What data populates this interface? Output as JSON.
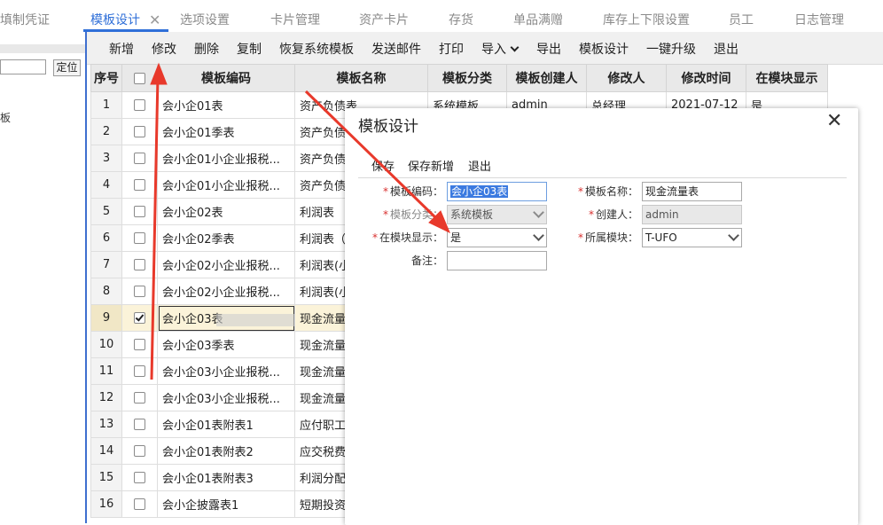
{
  "tabs": [
    {
      "label": "填制凭证"
    },
    {
      "label": "模板设计"
    },
    {
      "label": "选项设置"
    },
    {
      "label": "卡片管理"
    },
    {
      "label": "资产卡片"
    },
    {
      "label": "存货"
    },
    {
      "label": "单品满赠"
    },
    {
      "label": "库存上下限设置"
    },
    {
      "label": "员工"
    },
    {
      "label": "日志管理"
    }
  ],
  "left_panel": {
    "locate_button": "定位",
    "text": "板"
  },
  "toolbar": {
    "buttons": [
      {
        "label": "新增"
      },
      {
        "label": "修改"
      },
      {
        "label": "删除"
      },
      {
        "label": "复制"
      },
      {
        "label": "恢复系统模板"
      },
      {
        "label": "发送邮件"
      },
      {
        "label": "打印"
      },
      {
        "label": "导入"
      },
      {
        "label": "导出"
      },
      {
        "label": "模板设计"
      },
      {
        "label": "一键升级"
      },
      {
        "label": "退出"
      }
    ]
  },
  "grid": {
    "headers": {
      "idx": "序号",
      "code": "模板编码",
      "name": "模板名称",
      "category": "模板分类",
      "creator": "模板创建人",
      "modifier": "修改人",
      "modified_time": "修改时间",
      "show_in_module": "在模块显示"
    },
    "rows": [
      {
        "idx": "1",
        "checked": false,
        "code": "会小企01表",
        "name": "资产负债表",
        "category": "系统模板",
        "creator": "admin",
        "modifier": "总经理",
        "modified_time": "2021-07-12",
        "show": "是"
      },
      {
        "idx": "2",
        "checked": false,
        "code": "会小企01季表",
        "name": "资产负债",
        "category": "",
        "creator": "",
        "modifier": "",
        "modified_time": "",
        "show": ""
      },
      {
        "idx": "3",
        "checked": false,
        "code": "会小企01小企业报税...",
        "name": "资产负债",
        "category": "",
        "creator": "",
        "modifier": "",
        "modified_time": "",
        "show": ""
      },
      {
        "idx": "4",
        "checked": false,
        "code": "会小企01小企业报税...",
        "name": "资产负债",
        "category": "",
        "creator": "",
        "modifier": "",
        "modified_time": "",
        "show": ""
      },
      {
        "idx": "5",
        "checked": false,
        "code": "会小企02表",
        "name": "利润表",
        "category": "",
        "creator": "",
        "modifier": "",
        "modified_time": "",
        "show": ""
      },
      {
        "idx": "6",
        "checked": false,
        "code": "会小企02季表",
        "name": "利润表（",
        "category": "",
        "creator": "",
        "modifier": "",
        "modified_time": "",
        "show": ""
      },
      {
        "idx": "7",
        "checked": false,
        "code": "会小企02小企业报税...",
        "name": "利润表(小",
        "category": "",
        "creator": "",
        "modifier": "",
        "modified_time": "",
        "show": ""
      },
      {
        "idx": "8",
        "checked": false,
        "code": "会小企02小企业报税...",
        "name": "利润表(小",
        "category": "",
        "creator": "",
        "modifier": "",
        "modified_time": "",
        "show": ""
      },
      {
        "idx": "9",
        "checked": true,
        "code": "会小企03表",
        "name": "现金流量",
        "category": "",
        "creator": "",
        "modifier": "",
        "modified_time": "",
        "show": ""
      },
      {
        "idx": "10",
        "checked": false,
        "code": "会小企03季表",
        "name": "现金流量",
        "category": "",
        "creator": "",
        "modifier": "",
        "modified_time": "",
        "show": ""
      },
      {
        "idx": "11",
        "checked": false,
        "code": "会小企03小企业报税...",
        "name": "现金流量",
        "category": "",
        "creator": "",
        "modifier": "",
        "modified_time": "",
        "show": ""
      },
      {
        "idx": "12",
        "checked": false,
        "code": "会小企03小企业报税...",
        "name": "现金流量",
        "category": "",
        "creator": "",
        "modifier": "",
        "modified_time": "",
        "show": ""
      },
      {
        "idx": "13",
        "checked": false,
        "code": "会小企01表附表1",
        "name": "应付职工",
        "category": "",
        "creator": "",
        "modifier": "",
        "modified_time": "",
        "show": ""
      },
      {
        "idx": "14",
        "checked": false,
        "code": "会小企01表附表2",
        "name": "应交税费",
        "category": "",
        "creator": "",
        "modifier": "",
        "modified_time": "",
        "show": ""
      },
      {
        "idx": "15",
        "checked": false,
        "code": "会小企01表附表3",
        "name": "利润分配",
        "category": "",
        "creator": "",
        "modifier": "",
        "modified_time": "",
        "show": ""
      },
      {
        "idx": "16",
        "checked": false,
        "code": "会小企披露表1",
        "name": "短期投资",
        "category": "",
        "creator": "",
        "modifier": "",
        "modified_time": "",
        "show": ""
      }
    ]
  },
  "modal": {
    "title": "模板设计",
    "toolbar": {
      "save": "保存",
      "save_new": "保存新增",
      "exit": "退出"
    },
    "fields": {
      "code_label": "模板编码：",
      "code_value": "会小企03表",
      "name_label": "模板名称：",
      "name_value": "现金流量表",
      "category_label": "模板分类：",
      "category_value": "系统模板",
      "creator_label": "创建人：",
      "creator_value": "admin",
      "show_label": "在模块显示：",
      "show_value": "是",
      "module_label": "所属模块：",
      "module_value": "T-UFO",
      "note_label": "备注：",
      "note_value": ""
    },
    "required_mark": "*"
  },
  "colors": {
    "accent": "#2f6fd8",
    "arrow": "#e8392b",
    "selected_row": "#fbf3d9"
  }
}
